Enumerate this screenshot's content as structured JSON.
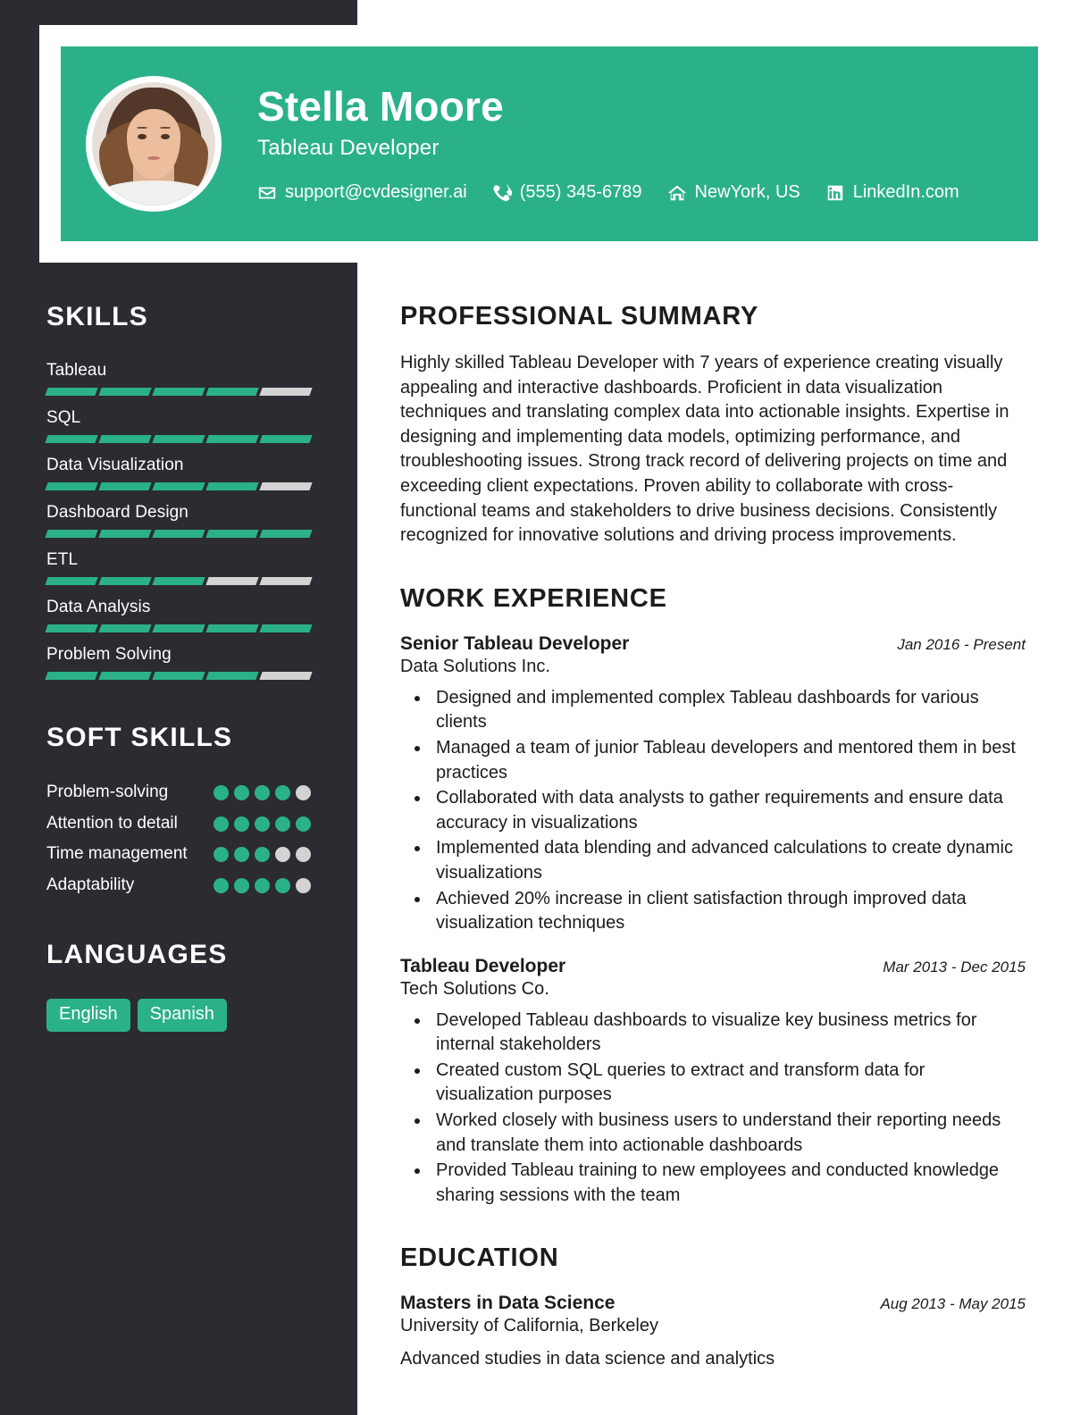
{
  "colors": {
    "accent": "#2bb189",
    "sidebar_bg": "#2b2b31",
    "inactive": "#d3d3d3",
    "page_bg": "#ffffff",
    "text": "#1c1c1c"
  },
  "header": {
    "name": "Stella Moore",
    "role": "Tableau Developer",
    "contacts": [
      {
        "icon": "envelope-icon",
        "text": "support@cvdesigner.ai"
      },
      {
        "icon": "phone-icon",
        "text": "(555) 345-6789"
      },
      {
        "icon": "home-icon",
        "text": "NewYork, US"
      },
      {
        "icon": "linkedin-icon",
        "text": "LinkedIn.com"
      }
    ]
  },
  "sidebar": {
    "skills_heading": "SKILLS",
    "skills": [
      {
        "label": "Tableau",
        "level": 4,
        "max": 5
      },
      {
        "label": "SQL",
        "level": 5,
        "max": 5
      },
      {
        "label": "Data Visualization",
        "level": 4,
        "max": 5
      },
      {
        "label": "Dashboard Design",
        "level": 5,
        "max": 5
      },
      {
        "label": "ETL",
        "level": 3,
        "max": 5
      },
      {
        "label": "Data Analysis",
        "level": 5,
        "max": 5
      },
      {
        "label": "Problem Solving",
        "level": 4,
        "max": 5
      }
    ],
    "soft_skills_heading": "SOFT SKILLS",
    "soft_skills": [
      {
        "label": "Problem-solving",
        "level": 4,
        "max": 5
      },
      {
        "label": "Attention to detail",
        "level": 5,
        "max": 5
      },
      {
        "label": "Time management",
        "level": 3,
        "max": 5
      },
      {
        "label": "Adaptability",
        "level": 4,
        "max": 5
      }
    ],
    "languages_heading": "LANGUAGES",
    "languages": [
      "English",
      "Spanish"
    ]
  },
  "main": {
    "summary_heading": "PROFESSIONAL SUMMARY",
    "summary_text": "Highly skilled Tableau Developer with 7 years of experience creating visually appealing and interactive dashboards. Proficient in data visualization techniques and translating complex data into actionable insights. Expertise in designing and implementing data models, optimizing performance, and troubleshooting issues. Strong track record of delivering projects on time and exceeding client expectations. Proven ability to collaborate with cross-functional teams and stakeholders to drive business decisions. Consistently recognized for innovative solutions and driving process improvements.",
    "experience_heading": "WORK EXPERIENCE",
    "jobs": [
      {
        "title": "Senior Tableau Developer",
        "date": "Jan 2016 - Present",
        "org": "Data Solutions Inc.",
        "bullets": [
          "Designed and implemented complex Tableau dashboards for various clients",
          "Managed a team of junior Tableau developers and mentored them in best practices",
          "Collaborated with data analysts to gather requirements and ensure data accuracy in visualizations",
          "Implemented data blending and advanced calculations to create dynamic visualizations",
          "Achieved 20% increase in client satisfaction through improved data visualization techniques"
        ]
      },
      {
        "title": "Tableau Developer",
        "date": "Mar 2013 - Dec 2015",
        "org": "Tech Solutions Co.",
        "bullets": [
          "Developed Tableau dashboards to visualize key business metrics for internal stakeholders",
          "Created custom SQL queries to extract and transform data for visualization purposes",
          "Worked closely with business users to understand their reporting needs and translate them into actionable dashboards",
          "Provided Tableau training to new employees and conducted knowledge sharing sessions with the team"
        ]
      }
    ],
    "education_heading": "EDUCATION",
    "education": [
      {
        "degree": "Masters in Data Science",
        "date": "Aug 2013 - May 2015",
        "school": "University of California, Berkeley",
        "description": "Advanced studies in data science and analytics"
      }
    ]
  }
}
